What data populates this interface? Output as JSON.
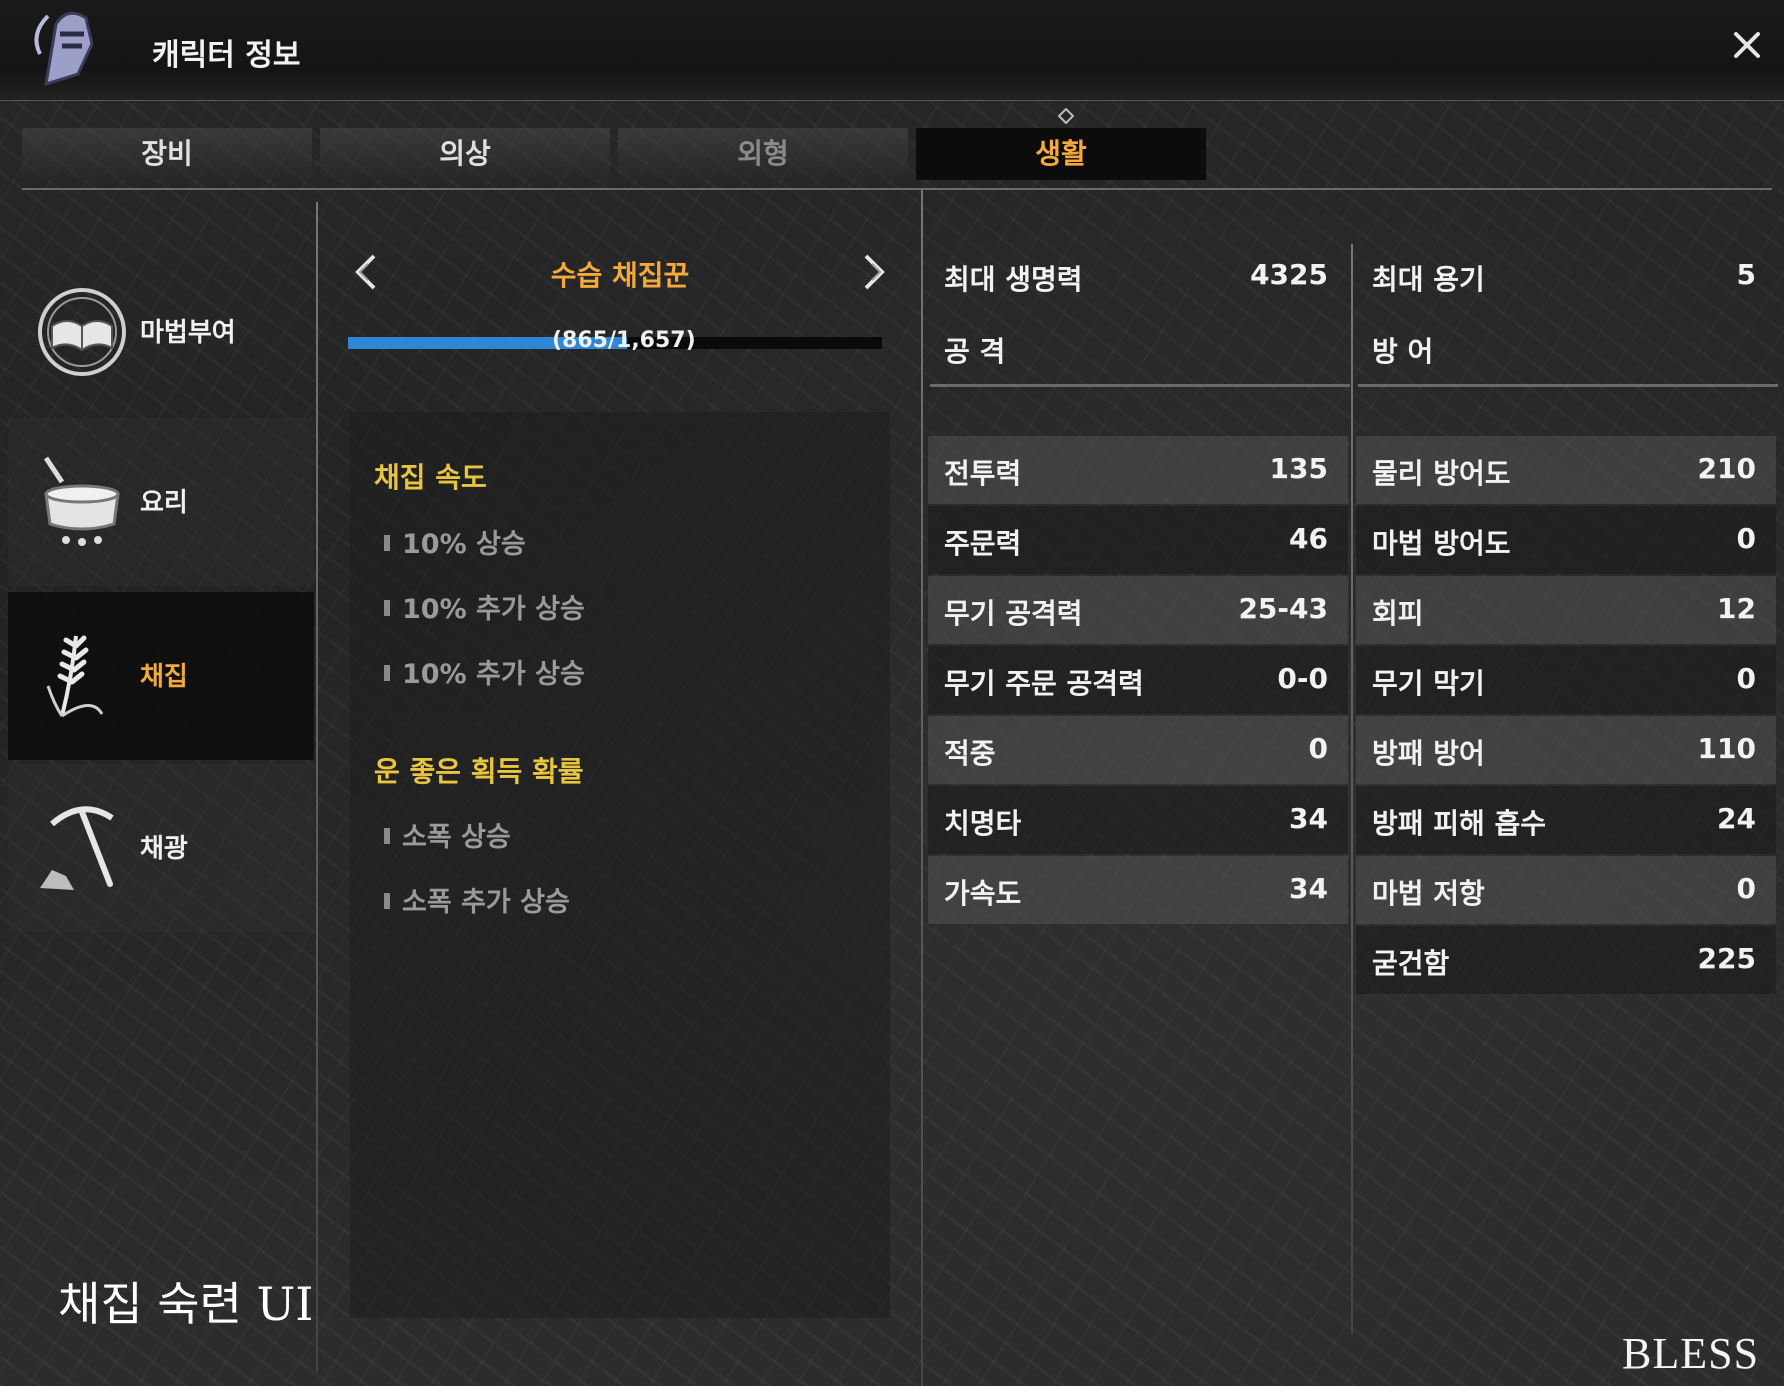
{
  "window": {
    "title": "캐릭터 정보",
    "close_label": "✕"
  },
  "tabs": [
    {
      "label": "장비",
      "state": "normal"
    },
    {
      "label": "의상",
      "state": "normal"
    },
    {
      "label": "외형",
      "state": "disabled"
    },
    {
      "label": "생활",
      "state": "active"
    }
  ],
  "categories": [
    {
      "label": "마법부여",
      "icon": "enchant-book-icon"
    },
    {
      "label": "요리",
      "icon": "cooking-pot-icon"
    },
    {
      "label": "채집",
      "icon": "wheat-icon",
      "active": true
    },
    {
      "label": "채광",
      "icon": "pickaxe-icon"
    }
  ],
  "profession": {
    "rank_title": "수습 채집꾼",
    "progress_text": "(865/1,657)",
    "progress_current": 865,
    "progress_max": 1657,
    "progress_color": "#2f86d6",
    "sections": [
      {
        "title": "채집 속도",
        "items": [
          "10% 상승",
          "10% 추가 상승",
          "10% 추가 상승"
        ]
      },
      {
        "title": "운 좋은 획득 확률",
        "items": [
          "소폭 상승",
          "소폭 추가 상승"
        ]
      }
    ]
  },
  "stats": {
    "top_left": {
      "name": "최대 생명력",
      "value": "4325"
    },
    "top_right": {
      "name": "최대 용기",
      "value": "5"
    },
    "attack_header": "공 격",
    "defense_header": "방 어",
    "attack": [
      {
        "name": "전투력",
        "value": "135"
      },
      {
        "name": "주문력",
        "value": "46"
      },
      {
        "name": "무기 공격력",
        "value": "25-43"
      },
      {
        "name": "무기 주문 공격력",
        "value": "0-0"
      },
      {
        "name": "적중",
        "value": "0"
      },
      {
        "name": "치명타",
        "value": "34"
      },
      {
        "name": "가속도",
        "value": "34"
      }
    ],
    "defense": [
      {
        "name": "물리 방어도",
        "value": "210"
      },
      {
        "name": "마법 방어도",
        "value": "0"
      },
      {
        "name": "회피",
        "value": "12"
      },
      {
        "name": "무기 막기",
        "value": "0"
      },
      {
        "name": "방패 방어",
        "value": "110"
      },
      {
        "name": "방패 피해 흡수",
        "value": "24"
      },
      {
        "name": "마법 저항",
        "value": "0"
      },
      {
        "name": "굳건함",
        "value": "225"
      }
    ]
  },
  "caption": "채집 숙련 UI",
  "logo": "BLESS",
  "colors": {
    "accent": "#f4a93a",
    "section_title": "#e8c540"
  }
}
